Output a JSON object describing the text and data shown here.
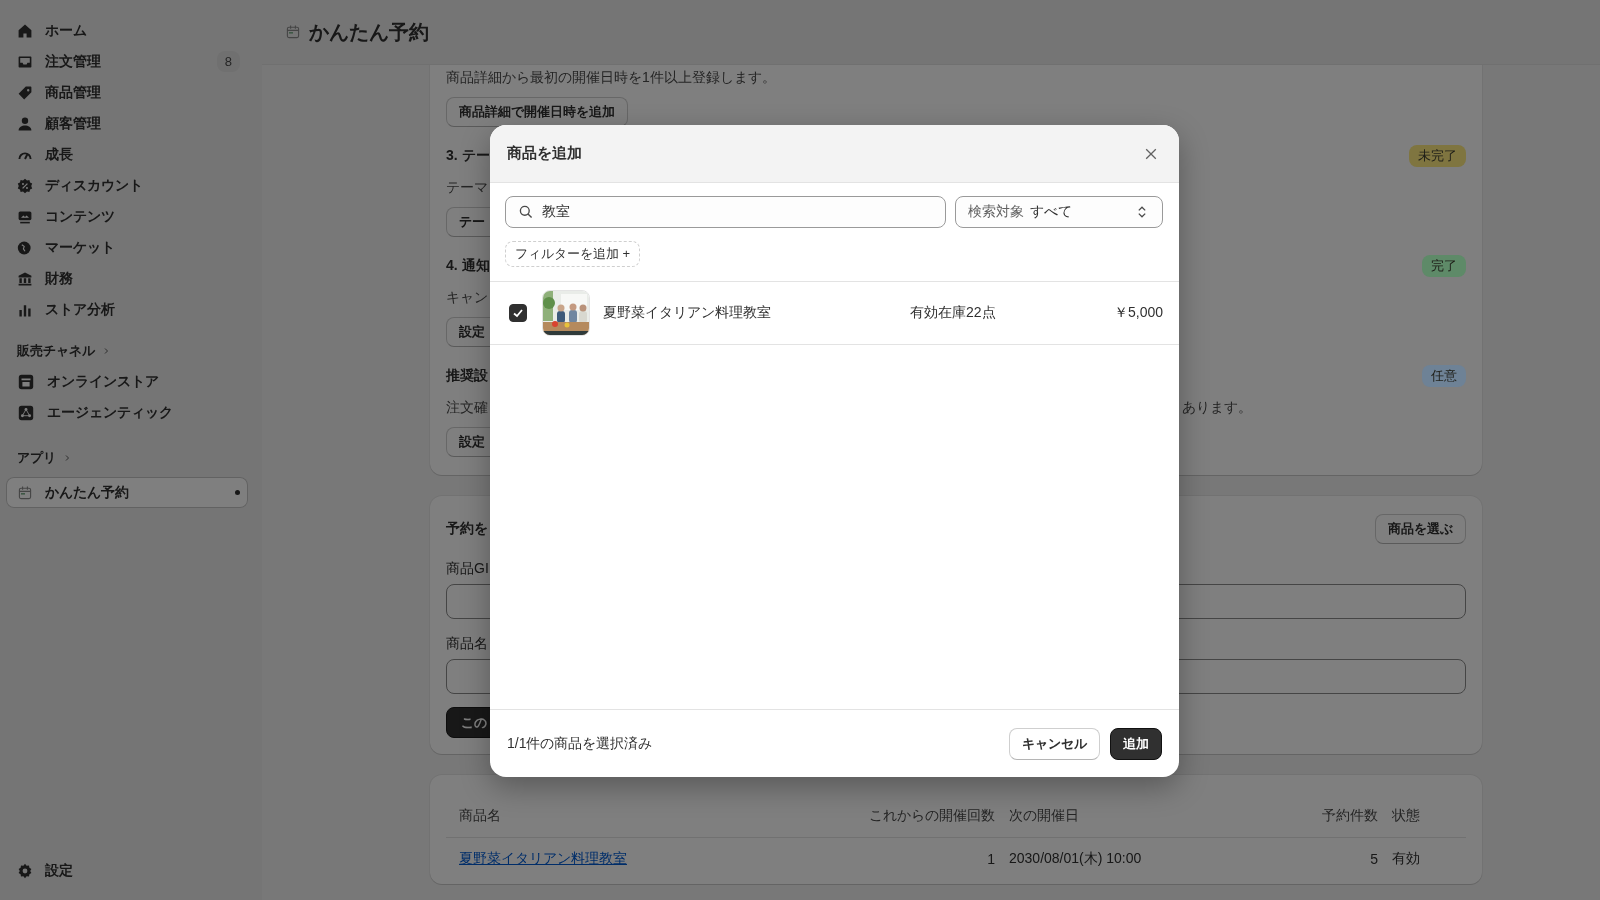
{
  "sidebar": {
    "nav": [
      {
        "label": "ホーム",
        "selected": false
      },
      {
        "label": "注文管理",
        "badge": "8",
        "selected": false
      },
      {
        "label": "商品管理",
        "selected": false
      },
      {
        "label": "顧客管理",
        "selected": false
      },
      {
        "label": "成長",
        "selected": false
      },
      {
        "label": "ディスカウント",
        "selected": false
      },
      {
        "label": "コンテンツ",
        "selected": false
      },
      {
        "label": "マーケット",
        "selected": false
      },
      {
        "label": "財務",
        "selected": false
      },
      {
        "label": "ストア分析",
        "selected": false
      }
    ],
    "channels": {
      "label": "販売チャネル",
      "items": [
        {
          "label": "オンラインストア",
          "selected": false
        },
        {
          "label": "エージェンティック",
          "selected": false
        }
      ]
    },
    "apps": {
      "label": "アプリ",
      "items": [
        {
          "label": "かんたん予約",
          "selected": true
        }
      ]
    },
    "settings": "設定"
  },
  "page": {
    "title": "かんたん予約"
  },
  "setup_card": {
    "intro": "商品詳細から最初の開催日時を1件以上登録します。",
    "intro_button": "商品詳細で開催日時を追加",
    "steps": [
      {
        "heading": "3. テー",
        "badge": {
          "label": "未完了",
          "color": "#7f7540"
        },
        "text": "テーマ",
        "button": "テー"
      },
      {
        "heading": "4. 通知",
        "badge": {
          "label": "完了",
          "color": "#5e8a68"
        },
        "text": "キャン",
        "button": "設定"
      },
      {
        "heading": "推奨設",
        "badge": {
          "label": "任意",
          "color": "#6e8296"
        },
        "text": "注文確",
        "text_end": "あります。",
        "button": "設定"
      }
    ]
  },
  "booking_card": {
    "title": "予約を",
    "pick_button": "商品を選ぶ",
    "fields": [
      {
        "label": "商品GI"
      },
      {
        "label": "商品名"
      }
    ],
    "submit": "この"
  },
  "events_table": {
    "columns": [
      "商品名",
      "これからの開催回数",
      "次の開催日",
      "予約件数",
      "状態"
    ],
    "rows": [
      {
        "cells": [
          "夏野菜イタリアン料理教室",
          "1",
          "2030/08/01(木) 10:00",
          "5",
          "有効"
        ]
      }
    ]
  },
  "modal": {
    "title": "商品を追加",
    "search": {
      "value": "教室"
    },
    "scope": {
      "label": "検索対象",
      "value": "すべて"
    },
    "filter_button": "フィルターを追加 +",
    "products": [
      {
        "name": "夏野菜イタリアン料理教室",
        "stock": "有効在庫22点",
        "price": "￥5,000",
        "checked": true
      }
    ],
    "footer": {
      "summary": "1/1件の商品を選択済み",
      "buttons": [
        {
          "label": "キャンセル",
          "kind": "secondary"
        },
        {
          "label": "追加",
          "kind": "primary"
        }
      ]
    }
  }
}
